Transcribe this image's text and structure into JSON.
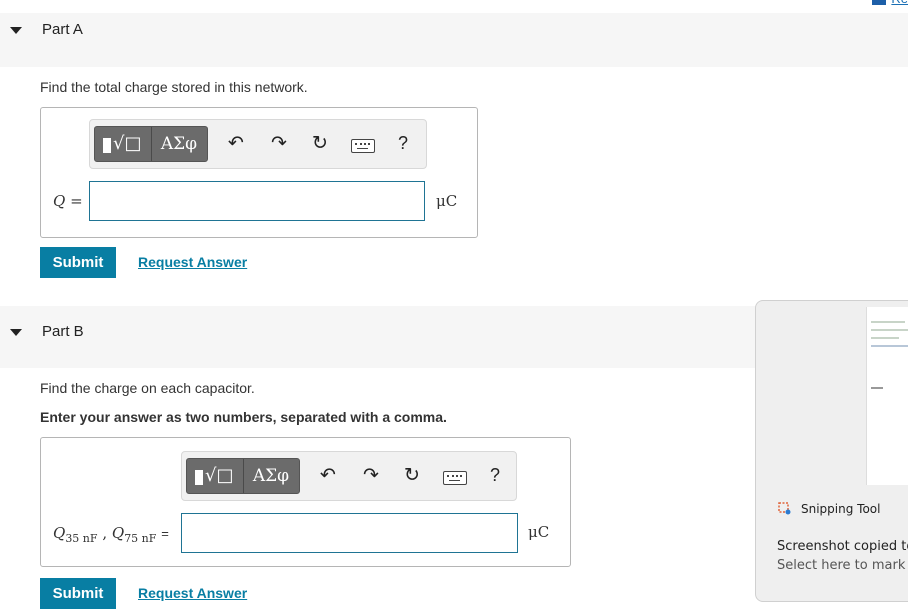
{
  "top_right_link": "Re",
  "part_a": {
    "title": "Part A",
    "prompt": "Find the total charge stored in this network.",
    "toolbar": {
      "symbols_label": "ΑΣφ",
      "templates_symbol": "√□",
      "help_label": "?"
    },
    "variable_label": "Q =",
    "input_value": "",
    "unit": "μC",
    "submit_label": "Submit",
    "request_answer_label": "Request Answer"
  },
  "part_b": {
    "title": "Part B",
    "prompt": "Find the charge on each capacitor.",
    "instruction": "Enter your answer as two numbers, separated with a comma.",
    "toolbar": {
      "symbols_label": "ΑΣφ",
      "templates_symbol": "√□",
      "help_label": "?"
    },
    "variable_label": {
      "q1": "Q",
      "q1_sub": "35 nF",
      "sep": ",",
      "q2": "Q",
      "q2_sub": "75 nF",
      "eq": "="
    },
    "input_value": "",
    "unit": "μC",
    "submit_label": "Submit",
    "request_answer_label": "Request Answer"
  },
  "notification": {
    "app_name": "Snipping Tool",
    "message": "Screenshot copied to",
    "sub_message": "Select here to mark u"
  },
  "icons": [
    "caret-down-icon",
    "undo-icon",
    "redo-icon",
    "reset-icon",
    "keyboard-icon",
    "help-icon",
    "snipping-tool-icon"
  ],
  "colors": {
    "accent": "#087ea3",
    "header_bg": "#f6f6f6",
    "toolbar_btn": "#6b6b6b",
    "input_border": "#1f7494"
  }
}
